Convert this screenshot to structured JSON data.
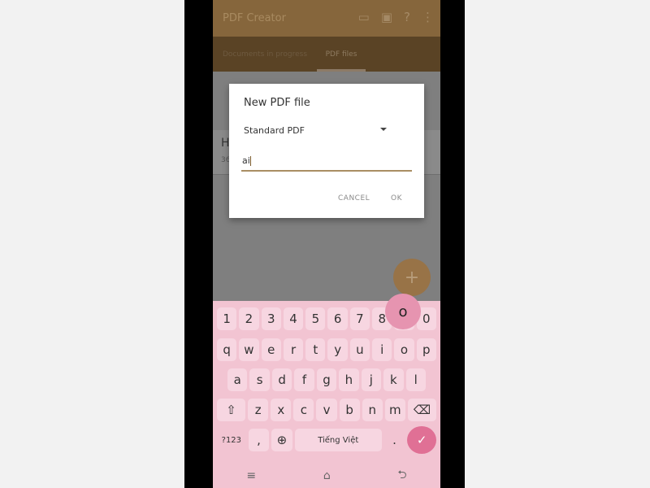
{
  "app": {
    "title": "PDF Creator",
    "icons": [
      "folder-icon",
      "cast-icon",
      "help-icon",
      "more-vert-icon"
    ]
  },
  "tabs": [
    {
      "label": "Documents in progress"
    },
    {
      "label": "PDF files"
    }
  ],
  "list": {
    "item_title": "H",
    "item_sub": "36"
  },
  "fab": {
    "label": "+"
  },
  "dialog": {
    "title": "New PDF file",
    "type_value": "Standard PDF",
    "input_value": "ai",
    "cancel": "CANCEL",
    "ok": "OK"
  },
  "keyboard": {
    "rows": [
      [
        "1",
        "2",
        "3",
        "4",
        "5",
        "6",
        "7",
        "8",
        "9",
        "0"
      ],
      [
        "q",
        "w",
        "e",
        "r",
        "t",
        "y",
        "u",
        "i",
        "o",
        "p"
      ],
      [
        "a",
        "s",
        "d",
        "f",
        "g",
        "h",
        "j",
        "k",
        "l"
      ],
      [
        "z",
        "x",
        "c",
        "v",
        "b",
        "n",
        "m"
      ]
    ],
    "shift": "⇧",
    "backspace": "⌫",
    "symbols": "?123",
    "comma": ",",
    "globe": "⊕",
    "space": "Tiếng Việt",
    "period": ".",
    "enter": "✓",
    "preview": "o",
    "accent": "#e07095"
  },
  "nav": {
    "menu": "≡",
    "home": "⌂",
    "back": "⮌"
  }
}
